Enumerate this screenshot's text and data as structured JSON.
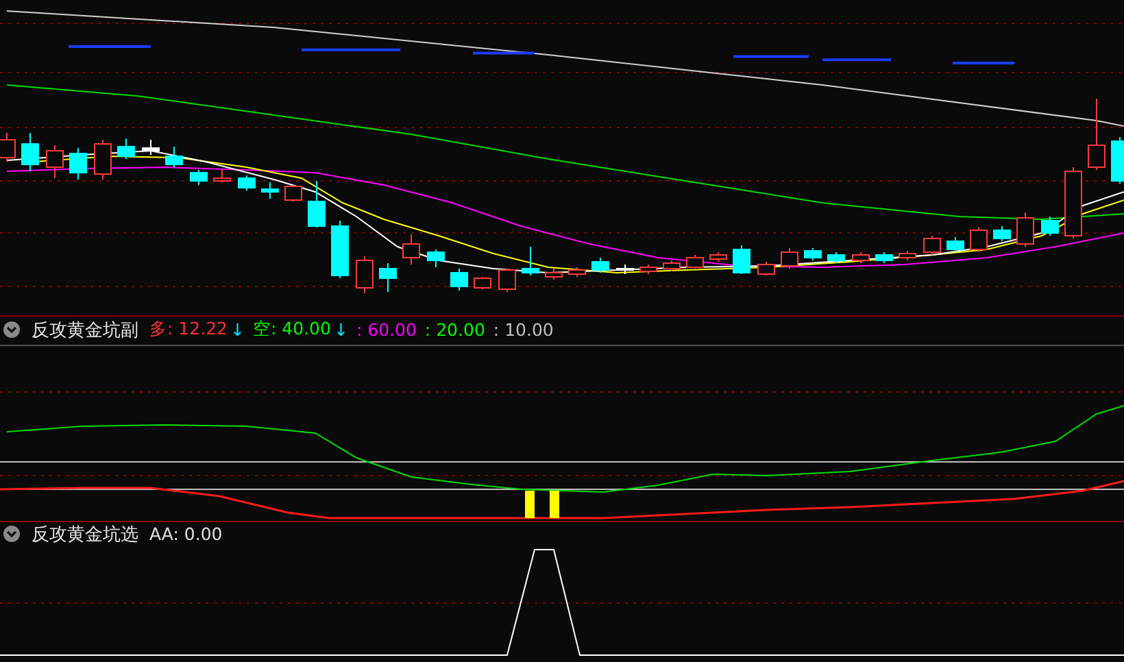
{
  "indicators": [
    {
      "title": "反攻黄金坑副",
      "items": [
        {
          "text": "多: 12.22",
          "arrow": "↓",
          "color": "#ff3030"
        },
        {
          "text": "空: 40.00",
          "arrow": "↓",
          "color": "#00ff00"
        },
        {
          "text": ": 60.00",
          "color": "#ff00ff"
        },
        {
          "text": ": 20.00",
          "color": "#00ff00"
        },
        {
          "text": ": 10.00",
          "color": "#c0c0c0"
        }
      ]
    },
    {
      "title": "反攻黄金坑选",
      "items": [
        {
          "text": "AA: 0.00",
          "color": "#e0e0e0"
        }
      ]
    }
  ]
}
